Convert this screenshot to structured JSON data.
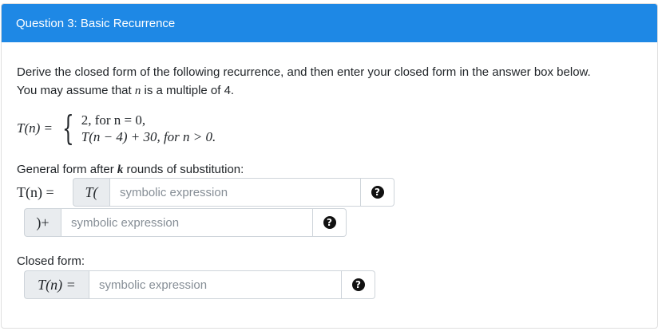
{
  "header": {
    "title": "Question 3: Basic Recurrence"
  },
  "intro": {
    "line1": "Derive the closed form of the following recurrence, and then enter your closed form in the answer box below.",
    "line2_prefix": "You may assume that ",
    "line2_var": "n",
    "line2_suffix": " is a multiple of 4."
  },
  "recurrence": {
    "lhs": "T(n) =",
    "case1": "2,  for n = 0,",
    "case2": "T(n − 4) + 30,  for n > 0."
  },
  "general": {
    "label_prefix": "General form after ",
    "label_var": "k",
    "label_suffix": " rounds of substitution:",
    "lhs": "T(n) =",
    "addon1": "T(",
    "placeholder1": "symbolic expression",
    "addon2": ")+",
    "placeholder2": "symbolic expression"
  },
  "closed": {
    "label": "Closed form:",
    "addon": "T(n) =",
    "placeholder": "symbolic expression"
  },
  "help_icon": "question-circle-icon",
  "colors": {
    "header_bg": "#1e88e5",
    "addon_bg": "#e9ecef",
    "border": "#ced4da"
  }
}
